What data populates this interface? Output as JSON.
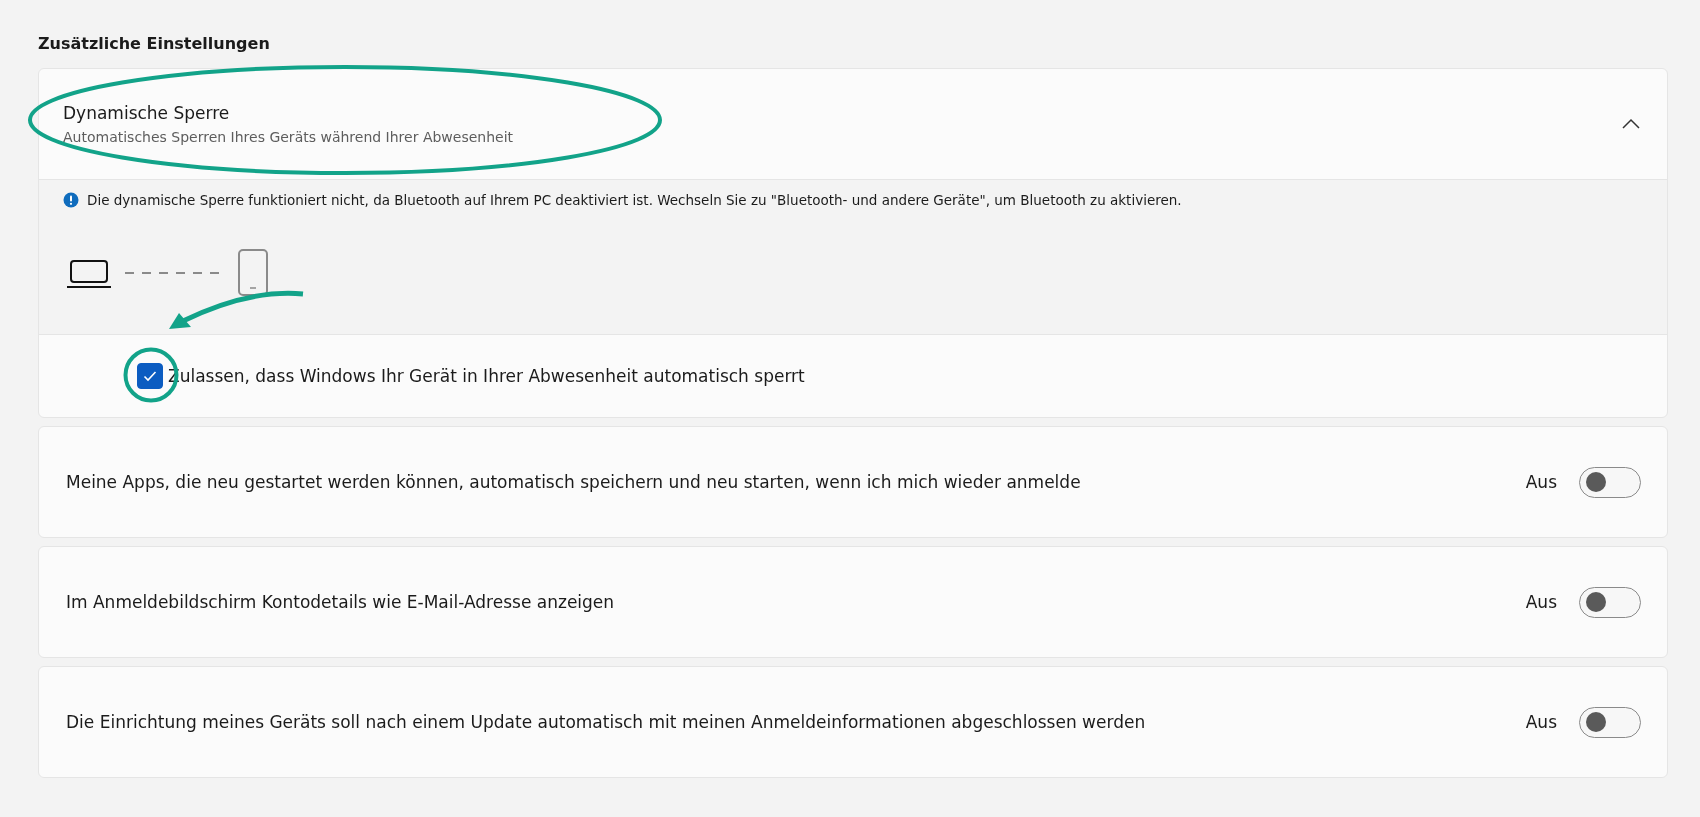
{
  "section_title": "Zusätzliche Einstellungen",
  "dynamic_lock": {
    "title": "Dynamische Sperre",
    "subtitle": "Automatisches Sperren Ihres Geräts während Ihrer Abwesenheit",
    "expanded": true,
    "info": "Die dynamische Sperre funktioniert nicht, da Bluetooth auf Ihrem PC deaktiviert ist. Wechseln Sie zu \"Bluetooth- und andere Geräte\", um Bluetooth zu aktivieren.",
    "checkbox": {
      "label": "Zulassen, dass Windows Ihr Gerät in Ihrer Abwesenheit automatisch sperrt",
      "checked": true
    }
  },
  "settings": [
    {
      "label": "Meine Apps, die neu gestartet werden können, automatisch speichern und neu starten, wenn ich mich wieder anmelde",
      "state_text": "Aus",
      "on": false
    },
    {
      "label": "Im Anmeldebildschirm Kontodetails wie E-Mail-Adresse anzeigen",
      "state_text": "Aus",
      "on": false
    },
    {
      "label": "Die Einrichtung meines Geräts soll nach einem Update automatisch mit meinen Anmeldeinformationen abgeschlossen werden",
      "state_text": "Aus",
      "on": false
    }
  ]
}
